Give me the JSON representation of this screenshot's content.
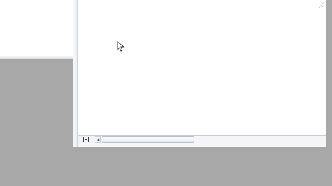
{
  "screen": {
    "desktop_color": "#a8a8a8",
    "window_background": "#ffffff"
  },
  "icons": {
    "cursor": "arrow-cursor-icon",
    "view_toggle": "split-view-icon",
    "scroll_left": "triangle-left-icon"
  },
  "scrollbar": {
    "left_arrow": "◂"
  }
}
